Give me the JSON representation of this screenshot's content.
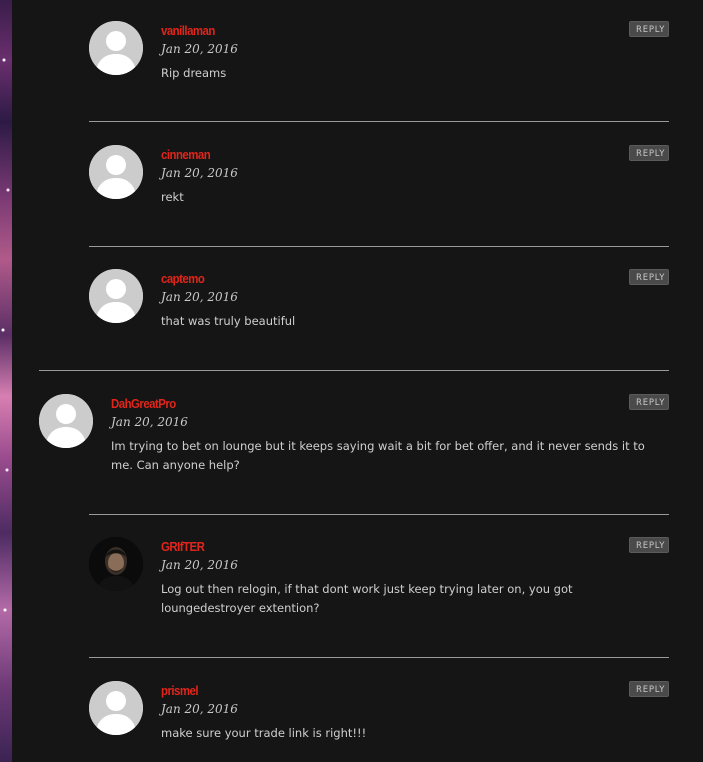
{
  "reply_label": "REPLY",
  "comments": [
    {
      "author": "vanillaman",
      "date": "Jan 20, 2016",
      "text": "Rip dreams",
      "avatar": "default-avatar"
    },
    {
      "author": "cinneman",
      "date": "Jan 20, 2016",
      "text": "rekt",
      "avatar": "default-avatar"
    },
    {
      "author": "captemo",
      "date": "Jan 20, 2016",
      "text": "that was truly beautiful",
      "avatar": "default-avatar"
    },
    {
      "author": "DahGreatPro",
      "date": "Jan 20, 2016",
      "text": "Im trying to bet on lounge but it keeps saying wait a bit for bet offer, and it never sends it to me. Can anyone help?",
      "avatar": "default-avatar"
    },
    {
      "author": "GRIfTER",
      "date": "Jan 20, 2016",
      "text": "Log out then relogin, if that dont work just keep trying later on, you got loungedestroyer extention?",
      "avatar": "photo-avatar"
    },
    {
      "author": "prismel",
      "date": "Jan 20, 2016",
      "text": "make sure your trade link is right!!!",
      "avatar": "default-avatar"
    }
  ]
}
